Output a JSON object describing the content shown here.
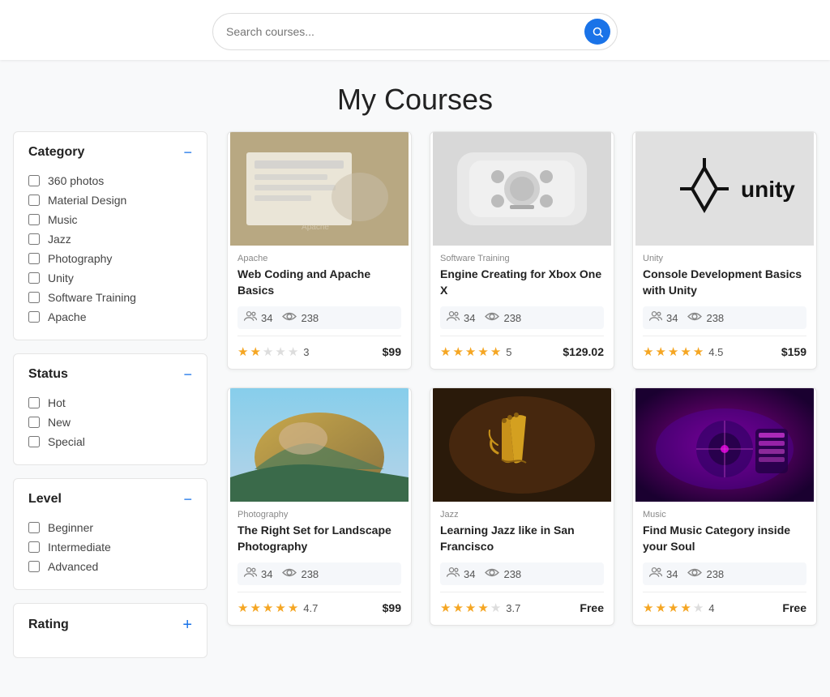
{
  "header": {
    "search_placeholder": "Search courses...",
    "page_title": "My Courses"
  },
  "sidebar": {
    "category": {
      "title": "Category",
      "items": [
        {
          "label": "360 photos"
        },
        {
          "label": "Material Design"
        },
        {
          "label": "Music"
        },
        {
          "label": "Jazz"
        },
        {
          "label": "Photography"
        },
        {
          "label": "Unity"
        },
        {
          "label": "Software Training"
        },
        {
          "label": "Apache"
        }
      ]
    },
    "status": {
      "title": "Status",
      "items": [
        {
          "label": "Hot"
        },
        {
          "label": "New"
        },
        {
          "label": "Special"
        }
      ]
    },
    "level": {
      "title": "Level",
      "items": [
        {
          "label": "Beginner"
        },
        {
          "label": "Intermediate"
        },
        {
          "label": "Advanced"
        }
      ]
    },
    "rating": {
      "title": "Rating"
    }
  },
  "courses": [
    {
      "id": 1,
      "category": "Apache",
      "title": "Web Coding and Apache Basics",
      "students": 34,
      "views": 238,
      "rating": 3.0,
      "full_stars": 2,
      "half_stars": 0,
      "empty_stars": 3,
      "price": "$99",
      "thumb_type": "coding",
      "thumb_color1": "#c9a87a",
      "thumb_color2": "#b8976a"
    },
    {
      "id": 2,
      "category": "Software Training",
      "title": "Engine Creating for Xbox One X",
      "students": 34,
      "views": 238,
      "rating": 5.0,
      "full_stars": 5,
      "half_stars": 0,
      "empty_stars": 0,
      "price": "$129.02",
      "thumb_type": "xbox",
      "thumb_color1": "#e0e0e0",
      "thumb_color2": "#cccccc"
    },
    {
      "id": 3,
      "category": "Unity",
      "title": "Console Development Basics with Unity",
      "students": 34,
      "views": 238,
      "rating": 4.5,
      "full_stars": 4,
      "half_stars": 1,
      "empty_stars": 0,
      "price": "$159",
      "thumb_type": "unity",
      "thumb_color1": "#d8d8d8",
      "thumb_color2": "#c0c0c0"
    },
    {
      "id": 4,
      "category": "Photography",
      "title": "The Right Set for Landscape Photography",
      "students": 34,
      "views": 238,
      "rating": 4.7,
      "full_stars": 4,
      "half_stars": 1,
      "empty_stars": 0,
      "price": "$99",
      "thumb_type": "landscape",
      "thumb_color1": "#c8a84b",
      "thumb_color2": "#4a8a6f"
    },
    {
      "id": 5,
      "category": "Jazz",
      "title": "Learning Jazz like in San Francisco",
      "students": 34,
      "views": 238,
      "rating": 3.7,
      "full_stars": 3,
      "half_stars": 1,
      "empty_stars": 1,
      "price": "Free",
      "thumb_type": "jazz",
      "thumb_color1": "#8b4513",
      "thumb_color2": "#d2691e"
    },
    {
      "id": 6,
      "category": "Music",
      "title": "Find Music Category inside your Soul",
      "students": 34,
      "views": 238,
      "rating": 4.0,
      "full_stars": 4,
      "half_stars": 0,
      "empty_stars": 1,
      "price": "Free",
      "thumb_type": "music",
      "thumb_color1": "#4b0082",
      "thumb_color2": "#8b008b"
    }
  ]
}
